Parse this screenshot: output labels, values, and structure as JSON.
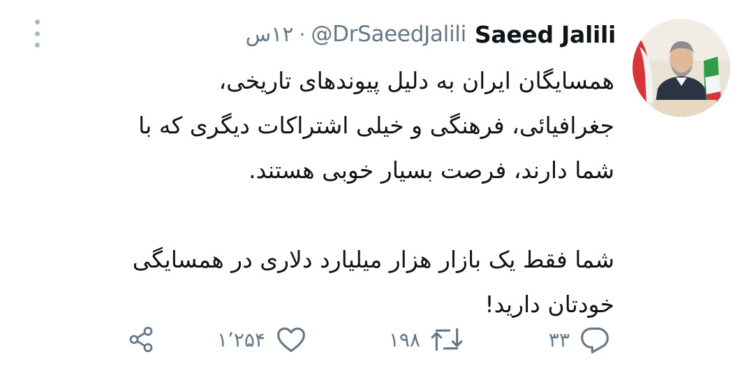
{
  "tweet": {
    "display_name": "Saeed Jalili",
    "handle": "@DrSaeedJalili",
    "separator": "·",
    "time": "۱۲س",
    "paragraphs": [
      [
        "همسایگان ایران به دلیل پیوندهای تاریخی،",
        "جغرافیائی، فرهنگی و خیلی اشتراکات دیگری که با",
        "شما دارند، فرصت بسیار خوبی هستند."
      ],
      [
        "شما فقط یک بازار هزار میلیارد دلاری  در همسایگی",
        "خودتان دارید!"
      ]
    ]
  },
  "actions": {
    "reply_count": "۳۳",
    "retweet_count": "۱۹۸",
    "like_count": "۱٬۲۵۴"
  },
  "icons": {
    "more": "more-vertical-icon",
    "reply": "reply-icon",
    "retweet": "retweet-icon",
    "like": "heart-icon",
    "share": "share-icon"
  },
  "colors": {
    "text": "#0f1419",
    "secondary": "#657786",
    "icon": "#657786",
    "more_dots": "#aab8c2"
  }
}
